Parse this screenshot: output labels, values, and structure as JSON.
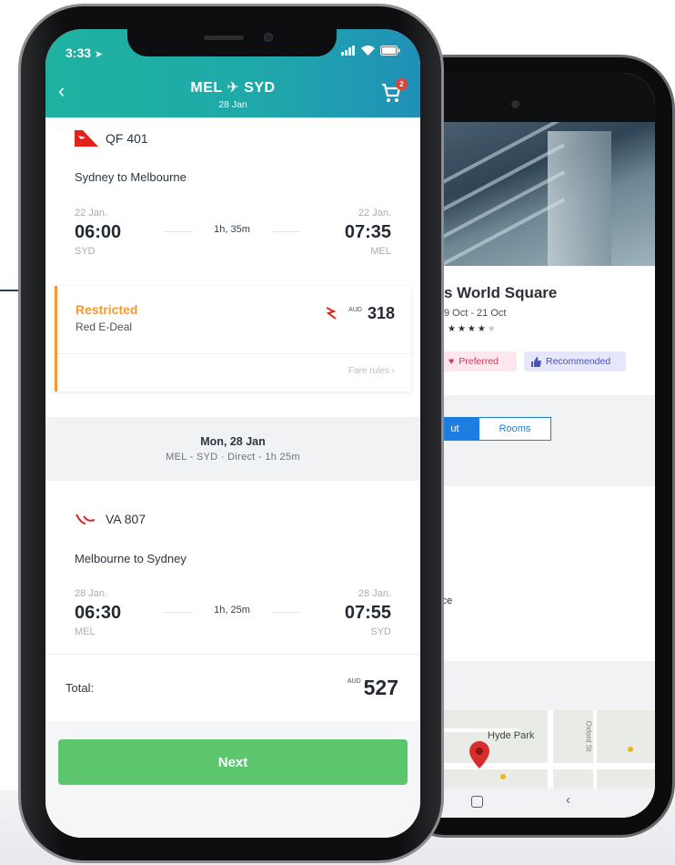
{
  "status_bar": {
    "time": "3:33"
  },
  "header": {
    "origin": "MEL",
    "destination": "SYD",
    "date": "28 Jan",
    "cart_count": "2"
  },
  "flight1": {
    "airline_code": "QF 401",
    "route": "Sydney to Melbourne",
    "dep_date": "22 Jan.",
    "dep_time": "06:00",
    "dep_code": "SYD",
    "duration": "1h, 35m",
    "arr_date": "22 Jan.",
    "arr_time": "07:35",
    "arr_code": "MEL"
  },
  "fare": {
    "type": "Restricted",
    "name": "Red E-Deal",
    "currency": "AUD",
    "amount": "318",
    "rules": "Fare rules ›"
  },
  "second_leg": {
    "day": "Mon, 28 Jan",
    "summary": "MEL - SYD · Direct - 1h 25m"
  },
  "flight2": {
    "airline_code": "VA 807",
    "route": "Melbourne to Sydney",
    "dep_date": "28 Jan.",
    "dep_time": "06:30",
    "dep_code": "MEL",
    "duration": "1h, 25m",
    "arr_date": "28 Jan.",
    "arr_time": "07:55",
    "arr_code": "SYD"
  },
  "total": {
    "label": "Total:",
    "currency": "AUD",
    "amount": "527"
  },
  "next_label": "Next",
  "hotel": {
    "name": "s World Square",
    "dates": "9 Oct - 21 Oct",
    "stars": "★★★★",
    "star_empty": "★",
    "badge_preferred": "Preferred",
    "badge_recommended": "Recommended",
    "tab_about": "ut",
    "tab_rooms": "Rooms",
    "service": "rvice",
    "map_label": "Hyde Park",
    "map_street": "Oxford St"
  },
  "colors": {
    "header_start": "#1fb2a1",
    "header_end": "#2190b8",
    "fare_accent": "#f29a31",
    "next_button": "#5cc66e",
    "badge_red": "#e2422f",
    "tab_blue": "#1e7de0"
  },
  "icons": [
    "back-arrow-icon",
    "plane-icon",
    "cart-icon",
    "qantas-logo-icon",
    "virgin-logo-icon",
    "signal-icon",
    "wifi-icon",
    "battery-icon",
    "location-arrow-icon",
    "heart-icon",
    "thumbs-up-icon",
    "map-pin-icon"
  ]
}
